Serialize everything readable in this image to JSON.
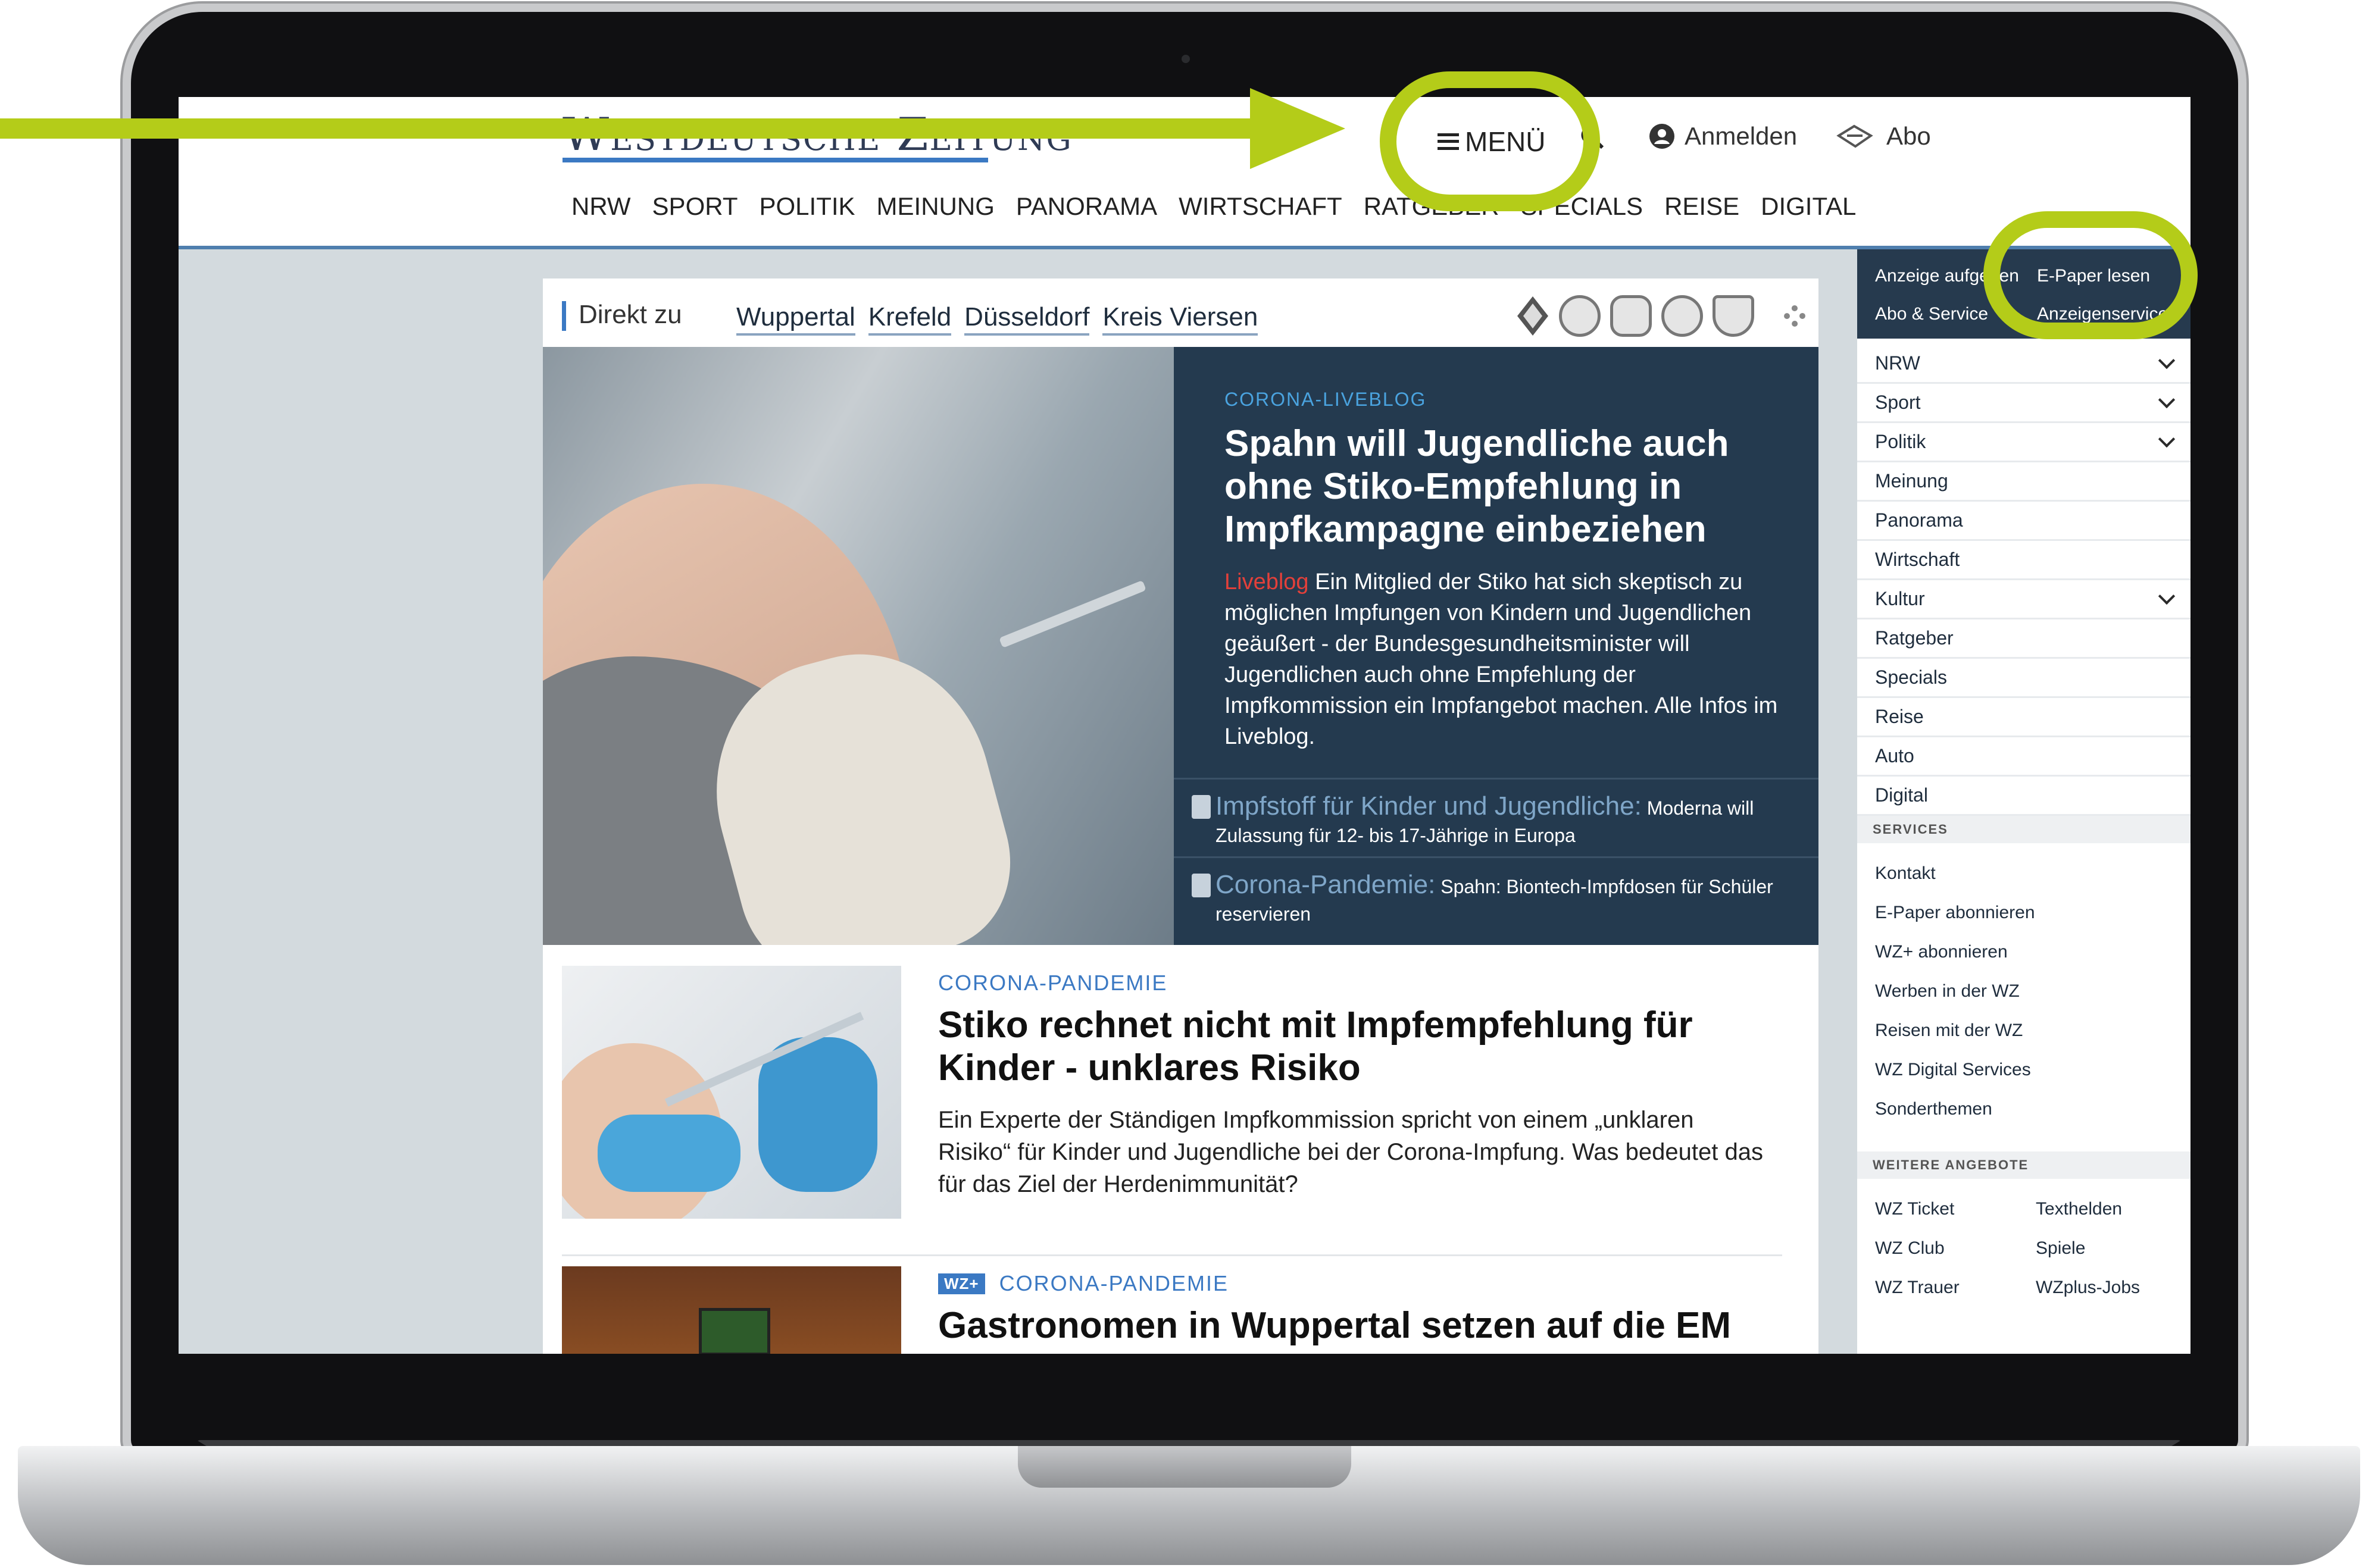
{
  "header": {
    "logo_text": "Westdeutsche Zeitung",
    "menu_label": "MENÜ",
    "login_label": "Anmelden",
    "abo_label": "Abo",
    "nav": [
      "NRW",
      "SPORT",
      "POLITIK",
      "MEINUNG",
      "PANORAMA",
      "WIRTSCHAFT",
      "RATGEBER",
      "SPECIALS",
      "REISE",
      "DIGITAL"
    ]
  },
  "direkt": {
    "label": "Direkt zu",
    "links": [
      "Wuppertal",
      "Krefeld",
      "Düsseldorf",
      "Kreis Viersen"
    ]
  },
  "hero": {
    "kicker": "CORONA-LIVEBLOG",
    "title": "Spahn will Jugendliche auch ohne Stiko-Empfehlung in Impfkampagne einbeziehen",
    "live_tag": "Liveblog",
    "lead": "Ein Mitglied der Stiko hat sich skeptisch zu möglichen Impfungen von Kindern und Jugendlichen geäußert - der Bundesgesundheitsminister will Jugendlichen auch ohne Empfehlung der Impfkommission ein Impfangebot machen. Alle Infos im Liveblog.",
    "related": [
      {
        "topic": "Impfstoff für Kinder und Jugendliche:",
        "text": "Moderna will Zulassung für 12- bis 17-Jährige in Europa"
      },
      {
        "topic": "Corona-Pandemie:",
        "text": "Spahn: Biontech-Impfdosen für Schüler reservieren"
      }
    ]
  },
  "articles": [
    {
      "kicker": "CORONA-PANDEMIE",
      "badge": "",
      "title": "Stiko rechnet nicht mit Impfempfehlung für Kinder - unklares Risiko",
      "body": "Ein Experte der Ständigen Impfkommission spricht von einem „unklaren Risiko“ für Kinder und Jugendliche bei der Corona-Impfung. Was bedeutet das für das Ziel der Herdenimmunität?"
    },
    {
      "kicker": "CORONA-PANDEMIE",
      "badge": "WZ+",
      "title": "Gastronomen in Wuppertal setzen auf die EM als",
      "body": ""
    }
  ],
  "panel": {
    "top": {
      "anzeige": "Anzeige aufgeben",
      "epaper": "E-Paper lesen",
      "abo_service": "Abo & Service",
      "anzeigenservice": "Anzeigenservice"
    },
    "sections": [
      {
        "label": "NRW",
        "expandable": true
      },
      {
        "label": "Sport",
        "expandable": true
      },
      {
        "label": "Politik",
        "expandable": true
      },
      {
        "label": "Meinung",
        "expandable": false
      },
      {
        "label": "Panorama",
        "expandable": false
      },
      {
        "label": "Wirtschaft",
        "expandable": false
      },
      {
        "label": "Kultur",
        "expandable": true
      },
      {
        "label": "Ratgeber",
        "expandable": false
      },
      {
        "label": "Specials",
        "expandable": false
      },
      {
        "label": "Reise",
        "expandable": false
      },
      {
        "label": "Auto",
        "expandable": false
      },
      {
        "label": "Digital",
        "expandable": false
      }
    ],
    "services_heading": "SERVICES",
    "services": [
      "Kontakt",
      "E-Paper abonnieren",
      "WZ+ abonnieren",
      "Werben in der WZ",
      "Reisen mit der WZ",
      "WZ Digital Services",
      "Sonderthemen"
    ],
    "weitere_heading": "WEITERE ANGEBOTE",
    "weitere": [
      "WZ Ticket",
      "Texthelden",
      "WZ Club",
      "Spiele",
      "WZ Trauer",
      "WZplus-Jobs"
    ]
  },
  "colors": {
    "annotation_green": "#b4cc19",
    "brand_blue": "#3b79c3",
    "hero_navy": "#243a4f"
  }
}
